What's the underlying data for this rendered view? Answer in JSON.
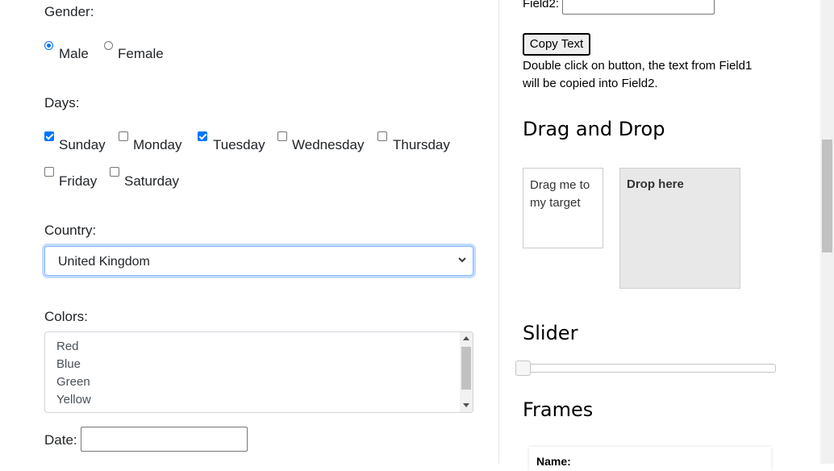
{
  "form": {
    "gender_label": "Gender:",
    "gender_options": [
      {
        "label": "Male",
        "checked": true
      },
      {
        "label": "Female",
        "checked": false
      }
    ],
    "days_label": "Days:",
    "days": [
      {
        "label": "Sunday",
        "checked": true
      },
      {
        "label": "Monday",
        "checked": false
      },
      {
        "label": "Tuesday",
        "checked": true
      },
      {
        "label": "Wednesday",
        "checked": false
      },
      {
        "label": "Thursday",
        "checked": false
      },
      {
        "label": "Friday",
        "checked": false
      },
      {
        "label": "Saturday",
        "checked": false
      }
    ],
    "country_label": "Country:",
    "country_selected": "United Kingdom",
    "colors_label": "Colors:",
    "colors": [
      "Red",
      "Blue",
      "Green",
      "Yellow"
    ],
    "date_label": "Date:",
    "date_value": ""
  },
  "right": {
    "field2_label": "Field2:",
    "field2_value": "",
    "copy_button": "Copy Text",
    "copy_help_1": "Double click on button, the text from Field1",
    "copy_help_2": "will be copied into Field2.",
    "drag_title": "Drag and Drop",
    "drag_text": "Drag me to my target",
    "drop_text": "Drop here",
    "slider_title": "Slider",
    "slider_value": 0,
    "frames_title": "Frames",
    "frame_name_label": "Name:"
  },
  "colors": {
    "accent": "#0075ff",
    "focus_border": "#86b7fe",
    "drop_bg": "#e8e8e8"
  }
}
